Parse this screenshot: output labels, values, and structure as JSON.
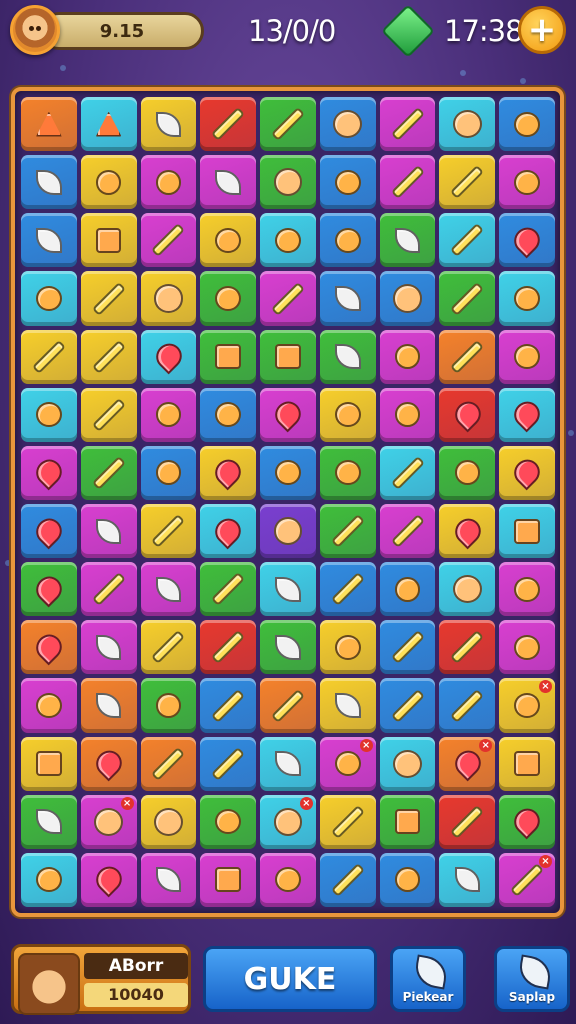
{
  "top_bar": {
    "score": "9.15",
    "progress": "13/0/0",
    "gems": "17:38",
    "add_label": "+"
  },
  "board": {
    "columns": 9,
    "rows": 14,
    "tiles": [
      [
        [
          "orange",
          "triangle"
        ],
        [
          "cyan",
          "triangle"
        ],
        [
          "yellow",
          "leaf"
        ],
        [
          "red",
          "stick"
        ],
        [
          "green",
          "stick"
        ],
        [
          "blue",
          "face"
        ],
        [
          "magenta",
          "stick"
        ],
        [
          "cyan",
          "face"
        ],
        [
          "blue",
          "round"
        ]
      ],
      [
        [
          "blue",
          "leaf"
        ],
        [
          "yellow",
          "round"
        ],
        [
          "magenta",
          "round"
        ],
        [
          "magenta",
          "leaf"
        ],
        [
          "green",
          "face"
        ],
        [
          "blue",
          "round"
        ],
        [
          "magenta",
          "stick"
        ],
        [
          "yellow",
          "stick"
        ],
        [
          "magenta",
          "round"
        ]
      ],
      [
        [
          "blue",
          "leaf"
        ],
        [
          "yellow",
          "square"
        ],
        [
          "magenta",
          "stick"
        ],
        [
          "yellow",
          "round"
        ],
        [
          "cyan",
          "round"
        ],
        [
          "blue",
          "round"
        ],
        [
          "green",
          "leaf"
        ],
        [
          "cyan",
          "stick"
        ],
        [
          "blue",
          "heart"
        ]
      ],
      [
        [
          "cyan",
          "round"
        ],
        [
          "yellow",
          "stick"
        ],
        [
          "yellow",
          "face"
        ],
        [
          "green",
          "round"
        ],
        [
          "magenta",
          "stick"
        ],
        [
          "blue",
          "leaf"
        ],
        [
          "blue",
          "face"
        ],
        [
          "green",
          "stick"
        ],
        [
          "cyan",
          "round"
        ]
      ],
      [
        [
          "yellow",
          "stick"
        ],
        [
          "yellow",
          "stick"
        ],
        [
          "cyan",
          "heart"
        ],
        [
          "green",
          "square"
        ],
        [
          "green",
          "square"
        ],
        [
          "green",
          "leaf"
        ],
        [
          "magenta",
          "round"
        ],
        [
          "orange",
          "stick"
        ],
        [
          "magenta",
          "round"
        ]
      ],
      [
        [
          "cyan",
          "round"
        ],
        [
          "yellow",
          "stick"
        ],
        [
          "magenta",
          "round"
        ],
        [
          "blue",
          "round"
        ],
        [
          "magenta",
          "heart"
        ],
        [
          "yellow",
          "round"
        ],
        [
          "magenta",
          "round"
        ],
        [
          "red",
          "heart"
        ],
        [
          "cyan",
          "heart"
        ]
      ],
      [
        [
          "magenta",
          "heart"
        ],
        [
          "green",
          "stick"
        ],
        [
          "blue",
          "round"
        ],
        [
          "yellow",
          "heart"
        ],
        [
          "blue",
          "round"
        ],
        [
          "green",
          "round"
        ],
        [
          "cyan",
          "stick"
        ],
        [
          "green",
          "round"
        ],
        [
          "yellow",
          "heart"
        ]
      ],
      [
        [
          "blue",
          "heart"
        ],
        [
          "magenta",
          "leaf"
        ],
        [
          "yellow",
          "stick"
        ],
        [
          "cyan",
          "heart"
        ],
        [
          "purple",
          "face"
        ],
        [
          "green",
          "stick"
        ],
        [
          "magenta",
          "stick"
        ],
        [
          "yellow",
          "heart"
        ],
        [
          "cyan",
          "square"
        ]
      ],
      [
        [
          "green",
          "heart"
        ],
        [
          "magenta",
          "stick"
        ],
        [
          "magenta",
          "leaf"
        ],
        [
          "green",
          "stick"
        ],
        [
          "cyan",
          "leaf"
        ],
        [
          "blue",
          "stick"
        ],
        [
          "blue",
          "round"
        ],
        [
          "cyan",
          "face"
        ],
        [
          "magenta",
          "round"
        ]
      ],
      [
        [
          "orange",
          "heart"
        ],
        [
          "magenta",
          "leaf"
        ],
        [
          "yellow",
          "stick"
        ],
        [
          "red",
          "stick"
        ],
        [
          "green",
          "leaf"
        ],
        [
          "yellow",
          "round"
        ],
        [
          "blue",
          "stick"
        ],
        [
          "red",
          "stick"
        ],
        [
          "magenta",
          "round"
        ]
      ],
      [
        [
          "magenta",
          "round"
        ],
        [
          "orange",
          "leaf"
        ],
        [
          "green",
          "round"
        ],
        [
          "blue",
          "stick"
        ],
        [
          "orange",
          "stick"
        ],
        [
          "yellow",
          "leaf"
        ],
        [
          "blue",
          "stick"
        ],
        [
          "blue",
          "stick"
        ],
        [
          "yellow",
          "round"
        ]
      ],
      [
        [
          "yellow",
          "square"
        ],
        [
          "orange",
          "heart"
        ],
        [
          "orange",
          "stick"
        ],
        [
          "blue",
          "stick"
        ],
        [
          "cyan",
          "leaf"
        ],
        [
          "magenta",
          "round"
        ],
        [
          "cyan",
          "face"
        ],
        [
          "orange",
          "heart"
        ],
        [
          "yellow",
          "square"
        ]
      ],
      [
        [
          "green",
          "leaf"
        ],
        [
          "magenta",
          "face"
        ],
        [
          "yellow",
          "face"
        ],
        [
          "green",
          "round"
        ],
        [
          "cyan",
          "face"
        ],
        [
          "yellow",
          "stick"
        ],
        [
          "green",
          "square"
        ],
        [
          "red",
          "stick"
        ],
        [
          "green",
          "heart"
        ]
      ],
      [
        [
          "cyan",
          "round"
        ],
        [
          "magenta",
          "heart"
        ],
        [
          "magenta",
          "leaf"
        ],
        [
          "magenta",
          "square"
        ],
        [
          "magenta",
          "round"
        ],
        [
          "blue",
          "stick"
        ],
        [
          "blue",
          "round"
        ],
        [
          "cyan",
          "leaf"
        ],
        [
          "magenta",
          "stick"
        ]
      ]
    ],
    "badges": [
      [
        10,
        8
      ],
      [
        11,
        5
      ],
      [
        11,
        7
      ],
      [
        12,
        1
      ],
      [
        12,
        4
      ],
      [
        13,
        8
      ]
    ]
  },
  "bottom_bar": {
    "player_name": "ABorr",
    "player_points": "10040",
    "main_button": "GUKE",
    "left_button": "Piekear",
    "right_button": "Saplap"
  },
  "colors": {
    "orange": "#f5822a",
    "cyan": "#3fd2e8",
    "yellow": "#f7cf2a",
    "red": "#e8392d",
    "green": "#3fbf3a",
    "blue": "#2f8ce0",
    "magenta": "#d93fd0",
    "purple": "#7a3fd0"
  }
}
